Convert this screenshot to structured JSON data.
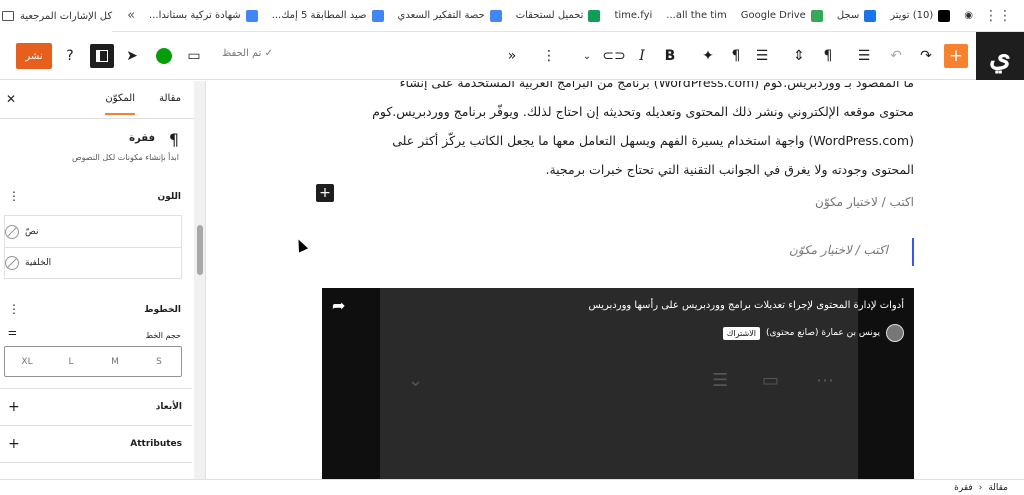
{
  "bookmarks": {
    "items": [
      {
        "label": "(10) تويتر",
        "icon_color": "#000000"
      },
      {
        "label": "سجل",
        "icon_color": "#1a73e8"
      },
      {
        "label": "Google Drive",
        "icon_color": "#34a853"
      },
      {
        "label": "all the tim...",
        "icon_color": "#777777"
      },
      {
        "label": "time.fyi",
        "icon_color": "#777777"
      },
      {
        "label": "تحميل لستحقات",
        "icon_color": "#0f9d58"
      },
      {
        "label": "حصة التفكير السعدي",
        "icon_color": "#4285f4"
      },
      {
        "label": "صيد المطابقة 5 إمك...",
        "icon_color": "#4285f4"
      },
      {
        "label": "شهادة تركية بستاندا...",
        "icon_color": "#4285f4"
      }
    ],
    "all_bookmarks_label": "كل الإشارات المرجعية"
  },
  "toolbar": {
    "logo": "ي",
    "publish_label": "نشر",
    "saved_label": "✓ تم الحفظ",
    "accent_color": "#f6822f"
  },
  "sidebar": {
    "tabs": [
      "مقالة",
      "المكوّن"
    ],
    "active_tab": "المكوّن",
    "block_title": "فقرة",
    "block_description": "ابدأ بإنشاء مكونات لكل النصوص",
    "color_title": "اللون",
    "color_text": "نصّ",
    "color_background": "الخلفية",
    "typography_title": "الخطوط",
    "font_size_label": "حجم الخط",
    "sizes": [
      "XL",
      "L",
      "M",
      "S"
    ],
    "dimensions_label": "الأبعاد",
    "attributes_label": "Attributes"
  },
  "content": {
    "paragraph_lines": [
      "ما المقصود بـ ووردبريس.كوم (WordPress.com) برنامج من البرامج العربية المستخدمة على إنشاء",
      "محتوى موقعه الإلكتروني ونشر ذلك المحتوى وتعديله وتحديثه إن احتاج لذلك. ويوفّر برنامج ووردبريس.كوم",
      "(WordPress.com) واجهة استخدام يسيرة الفهم ويسهل التعامل معها ما يجعل الكاتب يركّز أكثر على",
      "المحتوى وجودته ولا يغرق في الجوانب التقنية التي تحتاج خبرات برمجية."
    ],
    "placeholder": "اكتب / لاختيار مكوّن",
    "active_placeholder": "اكتب / لاختيار مكوّن"
  },
  "video": {
    "title": "أدوات لإدارة المحتوى لإجراء تعديلات برامج ووردبريس على رأسها ووردبريس",
    "channel": "يونس بن عمارة (صانع محتوى)",
    "subscribe": "الاشتراك"
  },
  "breadcrumb": [
    "مقالة",
    "فقرة"
  ]
}
